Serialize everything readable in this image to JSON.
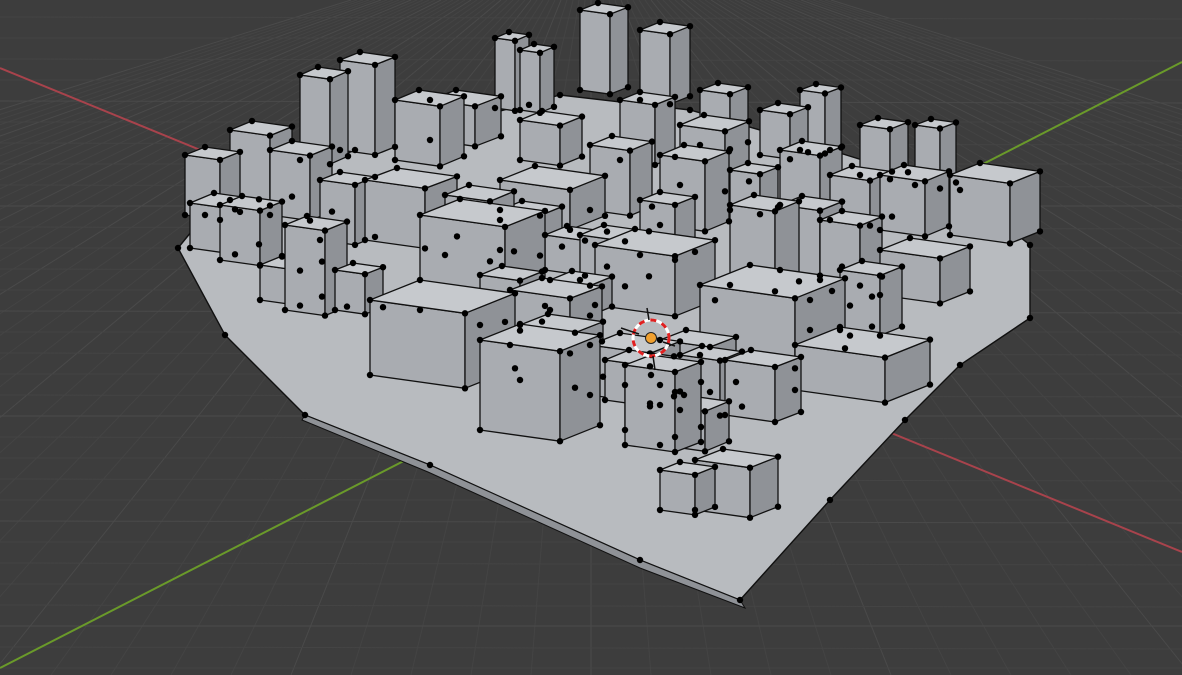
{
  "viewport": {
    "mode": "edit-mode",
    "view": "perspective",
    "object": "city-mesh"
  },
  "colors": {
    "background": "#3d3d3d",
    "grid_minor": "#444444",
    "grid_major": "#4a4a4a",
    "x_axis": "#a8434c",
    "y_axis": "#6a9a2a",
    "mesh_light": "#c6c9cd",
    "mesh_mid": "#a9acb1",
    "mesh_dark": "#8f9297",
    "mesh_ground": "#b8bbbf",
    "edge": "#111111",
    "vertex": "#000000",
    "cursor_ring_a": "#e02020",
    "cursor_ring_b": "#ffffff",
    "origin_dot": "#f0a030"
  },
  "icons": {
    "cursor": "3d-cursor-icon",
    "origin": "object-origin-icon"
  }
}
